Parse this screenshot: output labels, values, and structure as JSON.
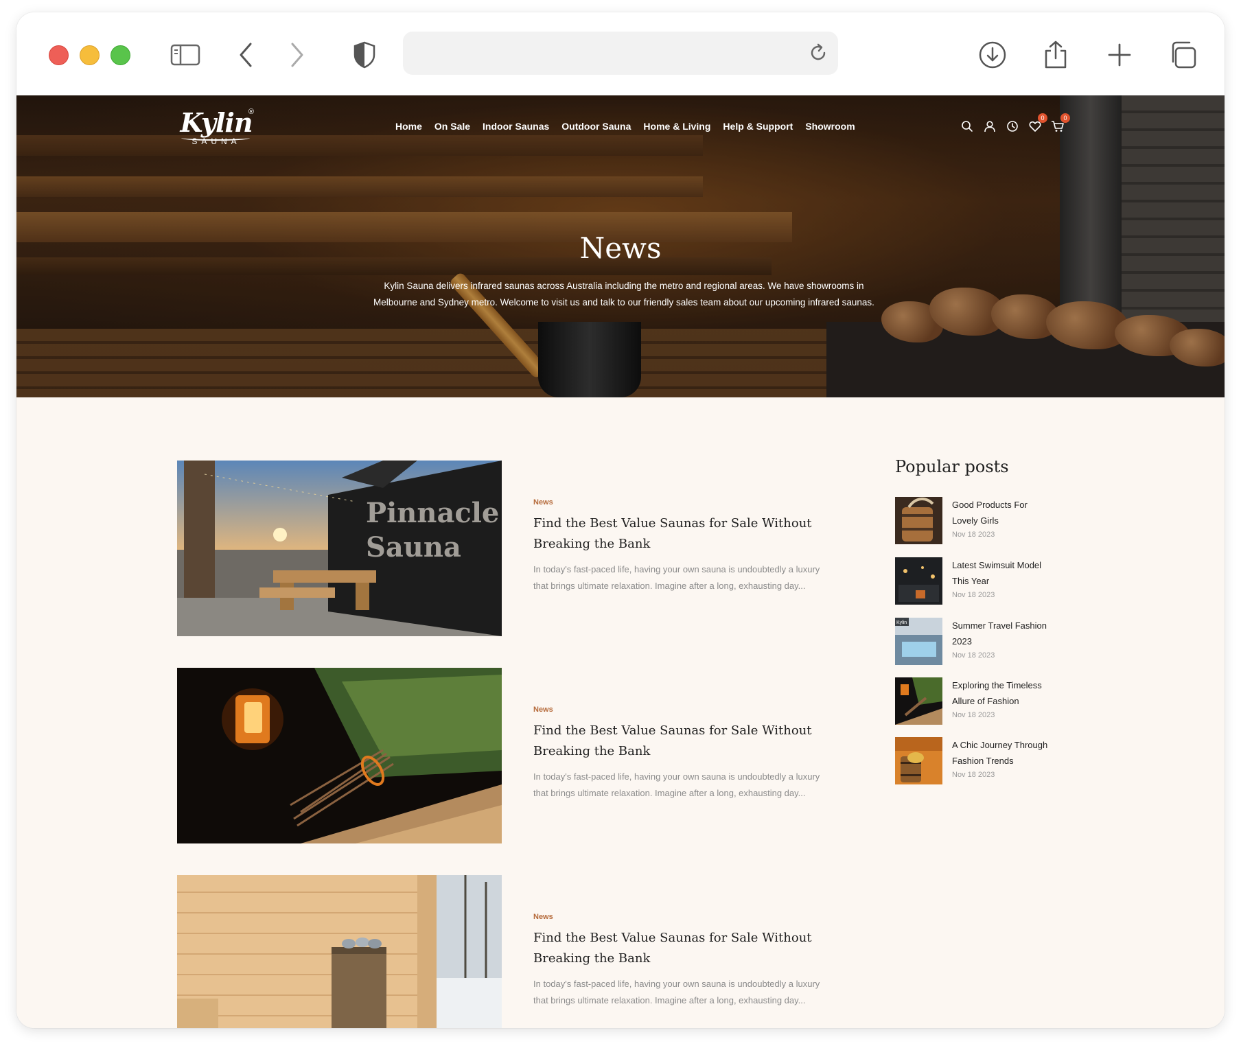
{
  "browser": {
    "url": "",
    "icons": [
      "sidebar-icon",
      "back-icon",
      "forward-icon",
      "shield-icon",
      "reload-icon",
      "download-icon",
      "share-icon",
      "new-tab-icon",
      "tabs-overview-icon"
    ]
  },
  "site": {
    "logo": {
      "name": "Kylin",
      "sub": "SAUNA",
      "reg": "®"
    },
    "nav": [
      "Home",
      "On Sale",
      "Indoor Saunas",
      "Outdoor Sauna",
      "Home & Living",
      "Help & Support",
      "Showroom"
    ],
    "header_icons": [
      "search-icon",
      "account-icon",
      "recent-icon",
      "wishlist-icon",
      "cart-icon"
    ],
    "wishlist_count": "0",
    "cart_count": "0",
    "accent": "#b56a3a"
  },
  "hero": {
    "title": "News",
    "description_line1": "Kylin Sauna delivers infrared saunas across Australia including the metro and regional areas. We have showrooms in",
    "description_line2": "Melbourne and Sydney metro. Welcome to visit us and talk to our friendly sales team about our upcoming infrared saunas."
  },
  "articles": [
    {
      "category": "News",
      "title_line1": "Find the Best Value Saunas for Sale Without",
      "title_line2": "Breaking the Bank",
      "excerpt_line1": "In today's fast-paced life, having your own sauna is undoubtedly a luxury",
      "excerpt_line2": "that brings ultimate relaxation. Imagine after a long, exhausting day..."
    },
    {
      "category": "News",
      "title_line1": "Find the Best Value Saunas for Sale Without",
      "title_line2": "Breaking the Bank",
      "excerpt_line1": "In today's fast-paced life, having your own sauna is undoubtedly a luxury",
      "excerpt_line2": "that brings ultimate relaxation. Imagine after a long, exhausting day..."
    },
    {
      "category": "News",
      "title_line1": "Find the Best Value Saunas for Sale Without",
      "title_line2": "Breaking the Bank",
      "excerpt_line1": "In today's fast-paced life, having your own sauna is undoubtedly a luxury",
      "excerpt_line2": "that brings ultimate relaxation. Imagine after a long, exhausting day..."
    }
  ],
  "sidebar": {
    "title": "Popular posts",
    "posts": [
      {
        "title_line1": "Good Products For",
        "title_line2": "Lovely Girls",
        "date": "Nov 18 2023"
      },
      {
        "title_line1": "Latest Swimsuit Model",
        "title_line2": "This Year",
        "date": "Nov 18 2023"
      },
      {
        "title_line1": "Summer Travel Fashion",
        "title_line2": "2023",
        "date": "Nov 18 2023"
      },
      {
        "title_line1": "Exploring the Timeless",
        "title_line2": "Allure of Fashion",
        "date": "Nov 18 2023"
      },
      {
        "title_line1": "A Chic Journey Through",
        "title_line2": "Fashion Trends",
        "date": "Nov 18 2023"
      }
    ]
  }
}
